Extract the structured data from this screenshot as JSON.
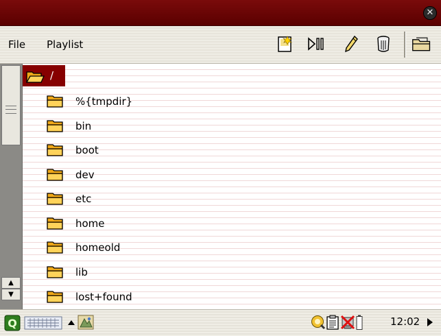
{
  "menu": {
    "file": "File",
    "playlist": "Playlist"
  },
  "toolbar": {
    "icons": [
      "new-icon",
      "play-pause-icon",
      "edit-icon",
      "trash-icon",
      "open-folder-icon"
    ]
  },
  "list": {
    "root": "/",
    "items": [
      {
        "label": "%{tmpdir}"
      },
      {
        "label": "bin"
      },
      {
        "label": "boot"
      },
      {
        "label": "dev"
      },
      {
        "label": "etc"
      },
      {
        "label": "home"
      },
      {
        "label": "homeold"
      },
      {
        "label": "lib"
      },
      {
        "label": "lost+found"
      }
    ]
  },
  "taskbar": {
    "clock": "12:02",
    "icons": [
      "start-icon",
      "keyboard-icon",
      "up-arrow-icon",
      "app-icon",
      "network-icon",
      "clipboard-icon",
      "no-connection-icon",
      "battery-icon",
      "right-arrow-icon"
    ]
  },
  "colors": {
    "titlebar": "#6a0404",
    "selection": "#860000",
    "folder": "#f0a818"
  }
}
